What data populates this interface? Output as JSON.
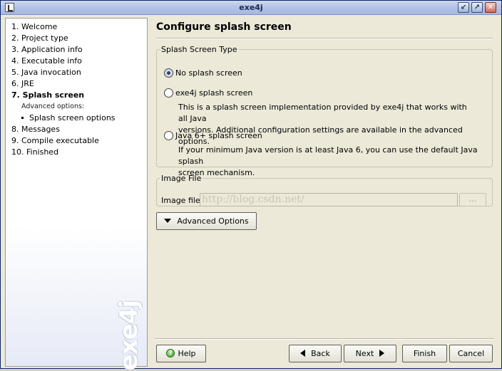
{
  "window": {
    "title": "exe4j",
    "controls": {
      "minimize": "↙",
      "maximize": "↗",
      "close": "✕"
    }
  },
  "sidebar": {
    "steps": [
      "1. Welcome",
      "2. Project type",
      "3. Application info",
      "4. Executable info",
      "5. Java invocation",
      "6. JRE",
      "7. Splash screen",
      "8. Messages",
      "9. Compile executable",
      "10. Finished"
    ],
    "active_step_index": 6,
    "advanced_options_label": "Advanced options:",
    "substeps": [
      "Splash screen options"
    ],
    "brand": "exe4j"
  },
  "page": {
    "title": "Configure splash screen",
    "splash_type_group": {
      "legend": "Splash Screen Type",
      "options": [
        {
          "label": "No splash screen",
          "checked": true,
          "description": ""
        },
        {
          "label": "exe4j splash screen",
          "checked": false,
          "description_lines": [
            "This is a splash screen implementation provided by exe4j that works with all Java",
            "versions. Additional configuration settings are available in the advanced options."
          ]
        },
        {
          "label": "Java 6+ splash screen",
          "checked": false,
          "description_lines": [
            "If your minimum Java version is at least Java 6, you can use the default Java splash",
            "screen mechanism."
          ]
        }
      ]
    },
    "image_file_group": {
      "legend": "Image File",
      "label": "Image file:",
      "value": "http://blog.csdn.net/",
      "browse_label": "..."
    },
    "advanced_button": "Advanced Options"
  },
  "footer": {
    "help": "Help",
    "back": "Back",
    "next": "Next",
    "finish": "Finish",
    "cancel": "Cancel"
  }
}
